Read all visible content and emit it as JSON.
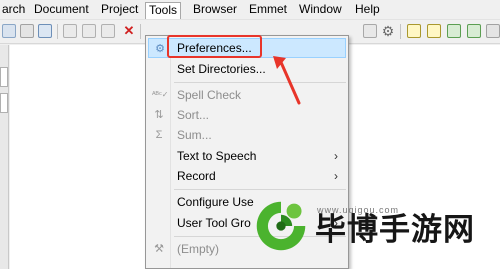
{
  "menubar": {
    "items": [
      "arch",
      "Document",
      "Project",
      "Tools",
      "Browser",
      "Emmet",
      "Window",
      "Help"
    ],
    "active": "Tools"
  },
  "toolbar": {
    "icons": [
      "replace-icon",
      "spellcheck-icon",
      "document-icon",
      "cut-icon",
      "copy-icon",
      "paste-icon",
      "delete-icon",
      "ruler-icon",
      "settings-icon",
      "layout-icon",
      "layout-alt-icon",
      "panel-icon",
      "window-icon"
    ]
  },
  "dropdown": {
    "items": [
      {
        "label": "Preferences...",
        "icon": "preferences-icon",
        "enabled": true,
        "highlighted": true
      },
      {
        "label": "Set Directories...",
        "enabled": true
      },
      {
        "label": "Spell Check",
        "icon": "spell-check-icon",
        "enabled": false
      },
      {
        "label": "Sort...",
        "icon": "sort-icon",
        "enabled": false
      },
      {
        "label": "Sum...",
        "icon": "sum-icon",
        "enabled": false
      },
      {
        "label": "Text to Speech",
        "enabled": true,
        "submenu": true
      },
      {
        "label": "Record",
        "enabled": true,
        "submenu": true
      },
      {
        "label": "Configure Use",
        "enabled": true
      },
      {
        "label": "User Tool Gro",
        "enabled": true,
        "submenu": true
      },
      {
        "label": "(Empty)",
        "icon": "tool-icon",
        "enabled": false
      }
    ]
  },
  "watermark": {
    "brand": "毕博手游网",
    "url": "www.uqigou.com"
  },
  "colors": {
    "highlight": "#cce8ff",
    "annotation_red": "#e8352a"
  }
}
